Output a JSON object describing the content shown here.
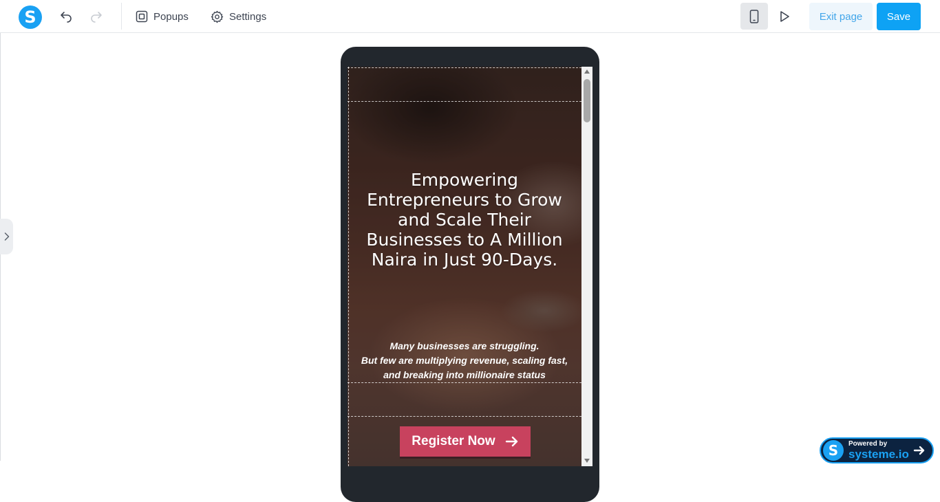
{
  "toolbar": {
    "logo_letter": "S",
    "popups_label": "Popups",
    "settings_label": "Settings",
    "exit_label": "Exit page",
    "save_label": "Save",
    "icons": [
      "undo-icon",
      "redo-icon",
      "popups-icon",
      "gear-icon",
      "mobile-device-icon",
      "play-icon"
    ]
  },
  "canvas": {
    "headline": "Empowering Entrepreneurs to Grow and Scale Their Businesses to A Million Naira in Just 90-Days.",
    "sub_line1": "Many businesses are struggling.",
    "sub_line2": "But few are multiplying revenue, scaling fast, and breaking into millionaire status",
    "cta_label": "Register Now"
  },
  "badge": {
    "logo_letter": "S",
    "powered_by": "Powered by",
    "brand": "systeme.io"
  },
  "colors": {
    "accent": "#1aa1f3",
    "save": "#0ea2f4",
    "cta": "#c8425e",
    "phone_frame": "#22272d"
  }
}
